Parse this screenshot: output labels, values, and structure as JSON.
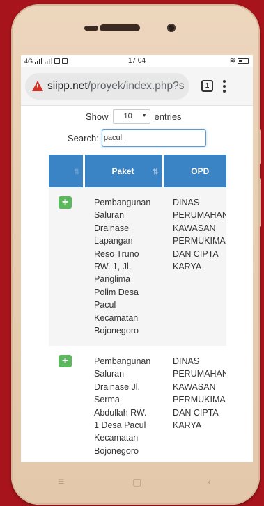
{
  "statusbar": {
    "network": "4G",
    "time": "17:04"
  },
  "browser": {
    "url_host": "siipp.net",
    "url_path": "/proyek/index.php?s",
    "tab_count": "1"
  },
  "table_controls": {
    "show_label": "Show",
    "page_size": "10",
    "entries_label": "entries",
    "search_label": "Search:",
    "search_value": "pacul"
  },
  "table": {
    "headers": [
      "",
      "Paket",
      "OPD"
    ],
    "rows": [
      {
        "paket_lines": [
          "Pembangunan",
          "Saluran",
          "Drainase",
          "Lapangan",
          "Reso Truno",
          "RW. 1, Jl.",
          "Panglima",
          "Polim Desa",
          "Pacul",
          "Kecamatan",
          "Bojonegoro"
        ],
        "opd_lines": [
          "DINAS",
          "PERUMAHAN",
          "KAWASAN",
          "PERMUKIMAN",
          "DAN CIPTA",
          "KARYA"
        ]
      },
      {
        "paket_lines": [
          "Pembangunan",
          "Saluran",
          "Drainase Jl.",
          "Serma",
          "Abdullah RW.",
          "1 Desa Pacul",
          "Kecamatan",
          "Bojonegoro"
        ],
        "opd_lines": [
          "DINAS",
          "PERUMAHAN",
          "KAWASAN",
          "PERMUKIMAN",
          "DAN CIPTA",
          "KARYA"
        ]
      }
    ]
  },
  "colors": {
    "background": "#a8141c",
    "header_blue": "#3a83c4",
    "expand_green": "#5cb85c",
    "warning_red": "#d93025"
  },
  "icons": {
    "insecure": "warning-triangle-icon",
    "menu": "kebab-menu-icon",
    "nav_menu": "menu-lines-icon",
    "nav_home": "home-circle-icon",
    "nav_back": "back-chevron-icon"
  }
}
